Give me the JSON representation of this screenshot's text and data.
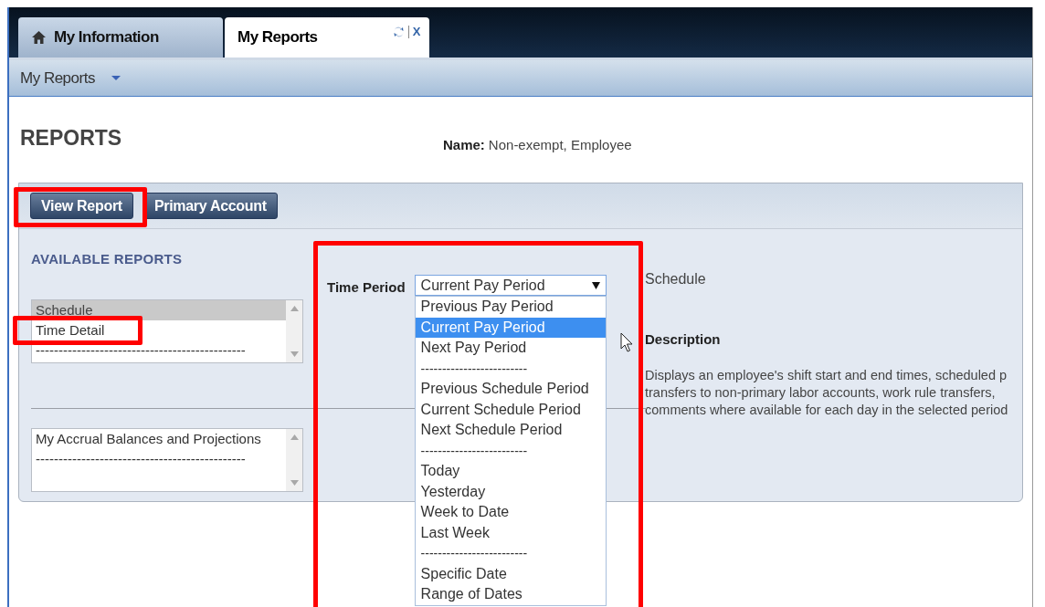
{
  "tabs": [
    {
      "label": "My Information",
      "selected": false,
      "kind": "home"
    },
    {
      "label": "My Reports",
      "selected": true,
      "kind": "closable"
    }
  ],
  "tab_actions": {
    "close": "X"
  },
  "toolbar": {
    "menu": "My Reports"
  },
  "page": {
    "title": "REPORTS",
    "name_label": "Name:",
    "name_value": "Non-exempt, Employee"
  },
  "buttons": [
    {
      "label": "View Report"
    },
    {
      "label": "Primary Account"
    }
  ],
  "available_reports": {
    "heading": "AVAILABLE REPORTS",
    "list_1": [
      {
        "label": "Schedule",
        "selected": true
      },
      {
        "label": "Time Detail",
        "selected": false
      },
      {
        "label": "----------------------------------------------",
        "selected": false
      }
    ],
    "list_2": [
      {
        "label": "My Accrual Balances and Projections",
        "selected": false
      },
      {
        "label": "----------------------------------------------",
        "selected": false
      }
    ]
  },
  "time_period": {
    "label": "Time Period",
    "value": "Current Pay Period",
    "expanded": true,
    "options": [
      {
        "label": "Previous Pay Period",
        "kind": "option",
        "selected": false
      },
      {
        "label": "Current Pay Period",
        "kind": "option",
        "selected": true
      },
      {
        "label": "Next Pay Period",
        "kind": "option",
        "selected": false
      },
      {
        "label": "-------------------------",
        "kind": "separator",
        "selected": false
      },
      {
        "label": "Previous Schedule Period",
        "kind": "option",
        "selected": false
      },
      {
        "label": "Current Schedule Period",
        "kind": "option",
        "selected": false
      },
      {
        "label": "Next Schedule Period",
        "kind": "option",
        "selected": false
      },
      {
        "label": "-------------------------",
        "kind": "separator",
        "selected": false
      },
      {
        "label": "Today",
        "kind": "option",
        "selected": false
      },
      {
        "label": "Yesterday",
        "kind": "option",
        "selected": false
      },
      {
        "label": "Week to Date",
        "kind": "option",
        "selected": false
      },
      {
        "label": "Last Week",
        "kind": "option",
        "selected": false
      },
      {
        "label": "-------------------------",
        "kind": "separator",
        "selected": false
      },
      {
        "label": "Specific Date",
        "kind": "option",
        "selected": false
      },
      {
        "label": "Range of Dates",
        "kind": "option",
        "selected": false
      }
    ]
  },
  "report_info": {
    "name": "Schedule",
    "description_heading": "Description",
    "description_lines": [
      "Displays an employee's shift start and end times, scheduled p",
      "transfers to non-primary labor accounts, work rule transfers,",
      "comments where available for each day in the selected period"
    ]
  }
}
